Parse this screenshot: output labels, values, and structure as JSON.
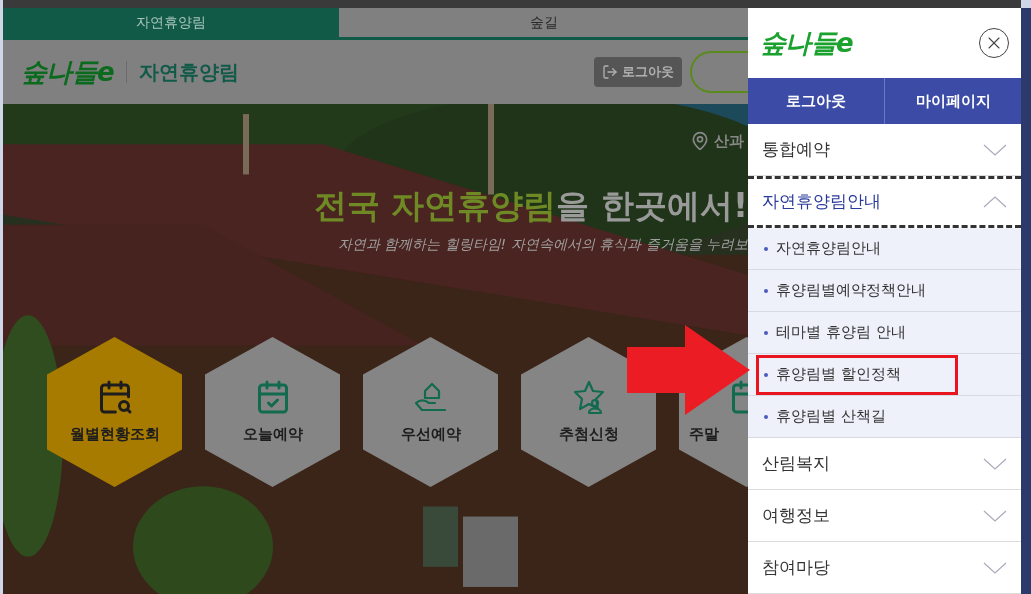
{
  "page": {
    "site_tabs": [
      {
        "label": "자연휴양림",
        "selected": true
      },
      {
        "label": "숲길",
        "selected": false
      }
    ],
    "header": {
      "logo": "숲나들e",
      "section_title": "자연휴양림",
      "logout_button": "로그아웃"
    },
    "hero": {
      "location": "산과",
      "headline_highlight": "전국 자연휴양림",
      "headline_rest": "을 한곳에서!",
      "subtitle": "자연과 함께하는 힐링타임! 자연속에서의 휴식과 즐거움을 누려보"
    },
    "quick_menu": [
      {
        "label": "월별현황조회",
        "kind": "calendar-search",
        "selected": true
      },
      {
        "label": "오늘예약",
        "kind": "calendar-check",
        "selected": false
      },
      {
        "label": "우선예약",
        "kind": "hand-house",
        "selected": false
      },
      {
        "label": "추첨신청",
        "kind": "star-person",
        "selected": false
      },
      {
        "label": "주말",
        "kind": "calendar",
        "selected": false
      }
    ]
  },
  "drawer": {
    "logo": "숲나들e",
    "buttons": [
      "로그아웃",
      "마이페이지"
    ],
    "menu": [
      {
        "label": "통합예약",
        "expanded": false
      },
      {
        "label": "자연휴양림안내",
        "expanded": true,
        "children": [
          {
            "label": "자연휴양림안내",
            "annotated": false
          },
          {
            "label": "휴양림별예약정책안내",
            "annotated": false
          },
          {
            "label": "테마별 휴양림 안내",
            "annotated": false
          },
          {
            "label": "휴양림별 할인정책",
            "annotated": true
          },
          {
            "label": "휴양림별 산책길",
            "annotated": false
          }
        ]
      },
      {
        "label": "산림복지",
        "expanded": false
      },
      {
        "label": "여행정보",
        "expanded": false
      },
      {
        "label": "참여마당",
        "expanded": false
      }
    ]
  }
}
